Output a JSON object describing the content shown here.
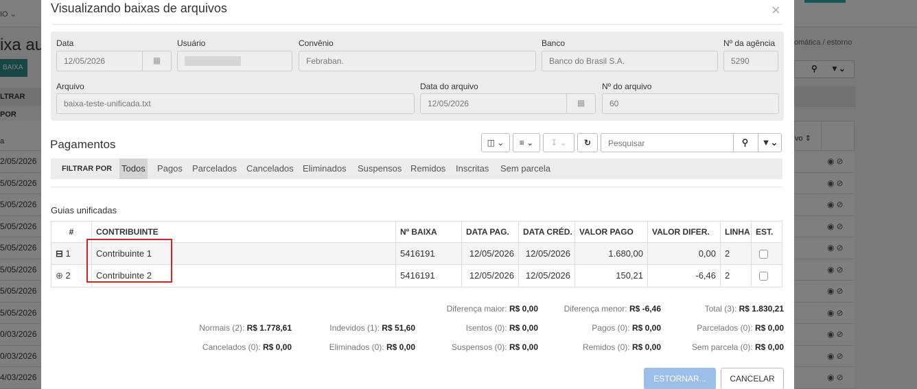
{
  "background": {
    "menu": "IO ⌄",
    "page_title": "ixa aut",
    "baixa_button": "BAIXA",
    "filter_label": "LTRAR POR",
    "col_label": "a",
    "breadcrumb_tail": "omática / estorno",
    "right_head": "vo ⇕",
    "row_dates": [
      "2/05/2026",
      "5/05/2026",
      "5/05/2026",
      "5/05/2026",
      "5/05/2026",
      "5/05/2026",
      "5/05/2026",
      "5/05/2026",
      "0/03/2026",
      "0/03/2026",
      "4/03/2026"
    ]
  },
  "modal": {
    "title": "Visualizando baixas de arquivos",
    "close": "×",
    "form": {
      "data_label": "Data",
      "data_value": "12/05/2026",
      "usuario_label": "Usuário",
      "convenio_label": "Convênio",
      "convenio_value": "Febraban.",
      "banco_label": "Banco",
      "banco_value": "Banco do Brasil S.A.",
      "agencia_label": "Nº da agência",
      "agencia_value": "5290",
      "arquivo_label": "Arquivo",
      "arquivo_value": "baixa-teste-unificada.txt",
      "data_arquivo_label": "Data do arquivo",
      "data_arquivo_value": "12/05/2026",
      "num_arquivo_label": "Nº do arquivo",
      "num_arquivo_value": "60"
    },
    "pagamentos": {
      "title": "Pagamentos",
      "search_placeholder": "Pesquisar",
      "filter_label": "FILTRAR POR",
      "filters": [
        "Todos",
        "Pagos",
        "Parcelados",
        "Cancelados",
        "Eliminados",
        "Suspensos",
        "Remidos",
        "Inscritas",
        "Sem parcela"
      ]
    },
    "guias": {
      "title": "Guias unificadas",
      "columns": [
        "#",
        "CONTRIBUINTE",
        "Nº BAIXA",
        "DATA PAG.",
        "DATA CRÉD.",
        "VALOR PAGO",
        "VALOR DIFER.",
        "LINHA",
        "EST."
      ],
      "rows": [
        {
          "num": "1",
          "contribuinte": "Contribuinte 1",
          "baixa": "5416191",
          "data_pag": "12/05/2026",
          "data_cred": "12/05/2026",
          "valor_pago": "1.680,00",
          "valor_difer": "0,00",
          "linha": "2"
        },
        {
          "num": "2",
          "contribuinte": "Contribuinte 2",
          "baixa": "5416191",
          "data_pag": "12/05/2026",
          "data_cred": "12/05/2026",
          "valor_pago": "150,21",
          "valor_difer": "-6,46",
          "linha": "2"
        }
      ]
    },
    "totals": {
      "dif_maior_label": "Diferença maior: ",
      "dif_maior": "R$ 0,00",
      "dif_menor_label": "Diferença menor: ",
      "dif_menor": "R$ -6,46",
      "total_label": "Total (3): ",
      "total": "R$ 1.830,21",
      "normais_label": "Normais (2): ",
      "normais": "R$ 1.778,61",
      "indevidos_label": "Indevidos (1): ",
      "indevidos": "R$ 51,60",
      "isentos_label": "Isentos (0): ",
      "isentos": "R$ 0,00",
      "pagos_label": "Pagos (0): ",
      "pagos": "R$ 0,00",
      "parcelados_label": "Parcelados (0): ",
      "parcelados": "R$ 0,00",
      "cancelados_label": "Cancelados (0): ",
      "cancelados": "R$ 0,00",
      "eliminados_label": "Eliminados (0): ",
      "eliminados": "R$ 0,00",
      "suspensos_label": "Suspensos (0): ",
      "suspensos": "R$ 0,00",
      "remidos_label": "Remidos (0): ",
      "remidos": "R$ 0,00",
      "semparcela_label": "Sem parcela (0): ",
      "semparcela": "R$ 0,00"
    },
    "buttons": {
      "estornar": "ESTORNAR...",
      "cancelar": "CANCELAR"
    }
  },
  "colors": {
    "highlight": "#d92020",
    "primary_disabled": "#9bbfe8",
    "bg_accent": "#2c8c8c"
  }
}
